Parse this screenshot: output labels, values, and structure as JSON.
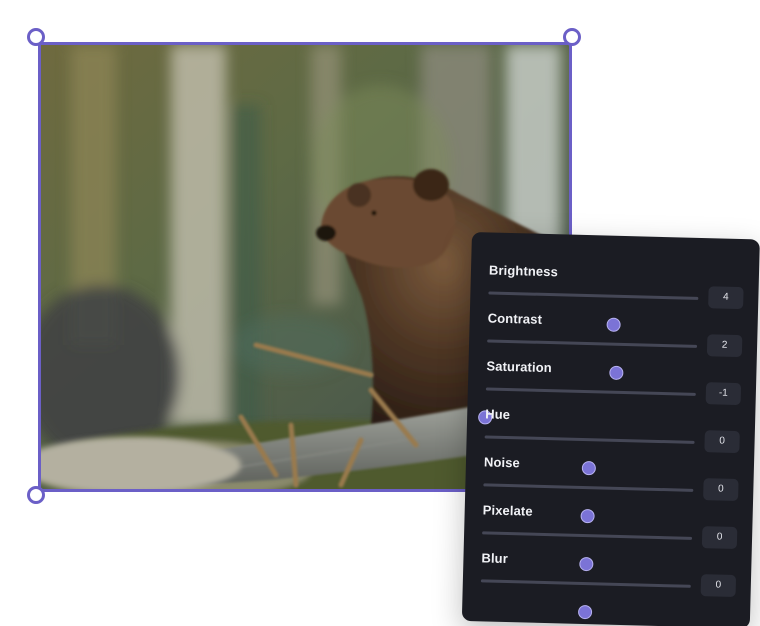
{
  "photo": {
    "subject": "brown bear in forest"
  },
  "adjustments": [
    {
      "label": "Brightness",
      "value": "4",
      "slider_fraction": 0.6
    },
    {
      "label": "Contrast",
      "value": "2",
      "slider_fraction": 0.62
    },
    {
      "label": "Saturation",
      "value": "-1",
      "slider_fraction": 0.0
    },
    {
      "label": "Hue",
      "value": "0",
      "slider_fraction": 0.5
    },
    {
      "label": "Noise",
      "value": "0",
      "slider_fraction": 0.5
    },
    {
      "label": "Pixelate",
      "value": "0",
      "slider_fraction": 0.5
    },
    {
      "label": "Blur",
      "value": "0",
      "slider_fraction": 0.5
    }
  ],
  "colors": {
    "accent": "#6b5fc7",
    "thumb": "#7b73d6",
    "panel_bg": "#1b1c23",
    "value_bg": "#2a2c36",
    "track": "#454756"
  }
}
